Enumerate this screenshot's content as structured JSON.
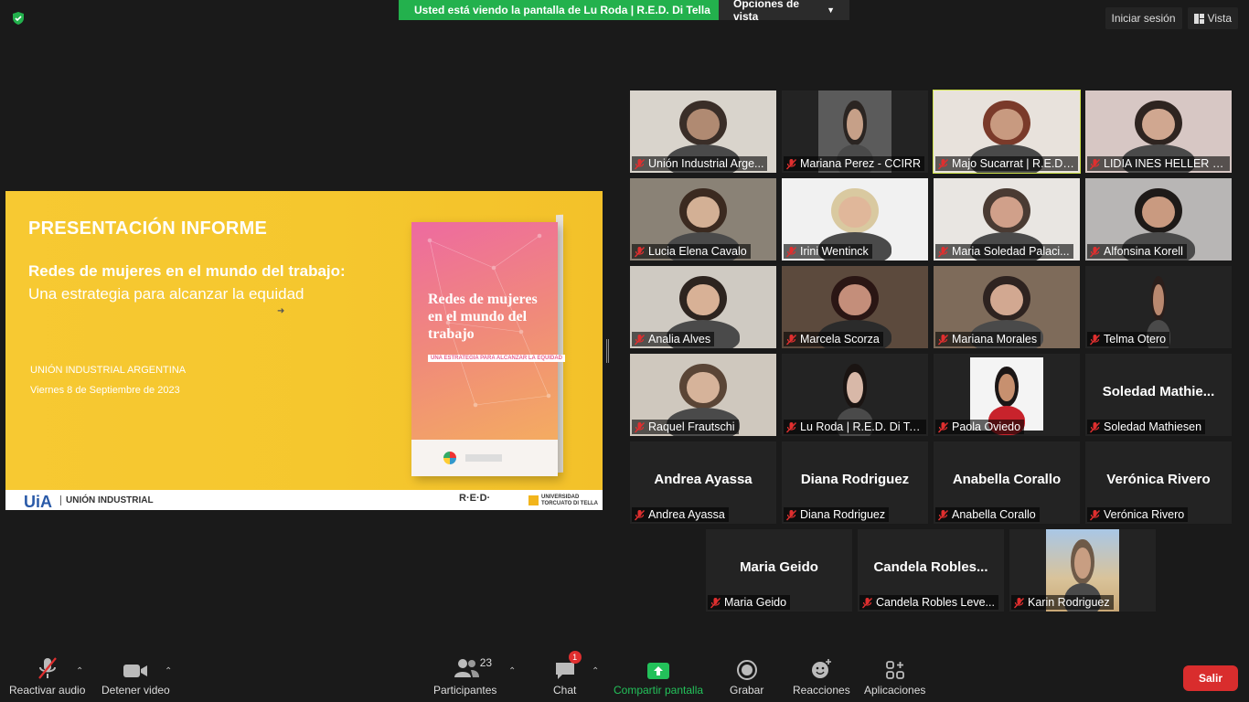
{
  "banner": {
    "viewing_text": "Usted está viendo la pantalla de Lu Roda | R.E.D. Di Tella",
    "view_options_label": "Opciones de vista"
  },
  "top_right": {
    "sign_in_label": "Iniciar sesión",
    "view_label": "Vista"
  },
  "presentation": {
    "heading": "PRESENTACIÓN INFORME",
    "subtitle_bold": "Redes de mujeres en el mundo del trabajo:",
    "subtitle": "Una estrategia para alcanzar la equidad",
    "organization": "UNIÓN INDUSTRIAL ARGENTINA",
    "date": "Viernes 8 de Septiembre de 2023",
    "book_title": "Redes de mujeres en el mundo del trabajo",
    "book_subtitle": "UNA ESTRATEGIA PARA ALCANZAR LA EQUIDAD",
    "footer_left_mark": "UiA",
    "footer_left_text": "UNIÓN INDUSTRIAL",
    "footer_red": "R·E·D·",
    "footer_utdt": "UNIVERSIDAD TORCUATO DI TELLA"
  },
  "participants": [
    {
      "name": "Unión Industrial Argentina",
      "display": "Unión Industrial Arge...",
      "video": true
    },
    {
      "name": "Mariana Perez - CCIRR",
      "display": "Mariana Perez - CCIRR",
      "video": true
    },
    {
      "name": "Majo Sucarrat | R.E.D. Di Tella",
      "display": "Majo Sucarrat | R.E.D. Di...",
      "video": true,
      "active": true
    },
    {
      "name": "LIDIA INES HELLER R.E.D.",
      "display": "LIDIA INES HELLER R.E.D...",
      "video": true
    },
    {
      "name": "Lucia Elena Cavalo",
      "display": "Lucia Elena Cavalo",
      "video": true
    },
    {
      "name": "Irini Wentinck",
      "display": "Irini Wentinck",
      "video": true
    },
    {
      "name": "Maria Soledad Palacios",
      "display": "Maria Soledad Palaci...",
      "video": true
    },
    {
      "name": "Alfonsina Korell",
      "display": "Alfonsina Korell",
      "video": true
    },
    {
      "name": "Analia Alves",
      "display": "Analia Alves",
      "video": true
    },
    {
      "name": "Marcela Scorza",
      "display": "Marcela Scorza",
      "video": true
    },
    {
      "name": "Mariana Morales",
      "display": "Mariana Morales",
      "video": true
    },
    {
      "name": "Telma Otero",
      "display": "Telma Otero",
      "video": true
    },
    {
      "name": "Raquel Frautschi",
      "display": "Raquel Frautschi",
      "video": true
    },
    {
      "name": "Lu Roda | R.E.D. Di Tella",
      "display": "Lu Roda | R.E.D. Di Te...",
      "video": true
    },
    {
      "name": "Paola Oviedo",
      "display": "Paola Oviedo",
      "video": true
    },
    {
      "name": "Soledad Mathiesen",
      "display": "Soledad Mathiesen",
      "big": "Soledad  Mathie...",
      "video": false
    },
    {
      "name": "Andrea Ayassa",
      "display": "Andrea Ayassa",
      "big": "Andrea Ayassa",
      "video": false
    },
    {
      "name": "Diana Rodriguez",
      "display": "Diana Rodriguez",
      "big": "Diana Rodriguez",
      "video": false
    },
    {
      "name": "Anabella Corallo",
      "display": "Anabella Corallo",
      "big": "Anabella Corallo",
      "video": false
    },
    {
      "name": "Verónica Rivero",
      "display": "Verónica Rivero",
      "big": "Verónica Rivero",
      "video": false
    },
    {
      "name": "Maria Geido",
      "display": "Maria Geido",
      "big": "Maria Geido",
      "video": false
    },
    {
      "name": "Candela Robles Leve",
      "display": "Candela Robles Leve...",
      "big": "Candela  Robles...",
      "video": false
    },
    {
      "name": "Karin Rodriguez",
      "display": "Karin Rodriguez",
      "video": true
    }
  ],
  "toolbar": {
    "unmute_label": "Reactivar audio",
    "stop_video_label": "Detener video",
    "participants_label": "Participantes",
    "participants_count": "23",
    "chat_label": "Chat",
    "chat_badge": "1",
    "share_label": "Compartir pantalla",
    "record_label": "Grabar",
    "reactions_label": "Reacciones",
    "apps_label": "Aplicaciones",
    "leave_label": "Salir"
  },
  "colors": {
    "share_green": "#23b14d",
    "active_speaker": "#cfe34a",
    "leave_red": "#d92d2d",
    "slide_yellow": "#f5c72e"
  }
}
